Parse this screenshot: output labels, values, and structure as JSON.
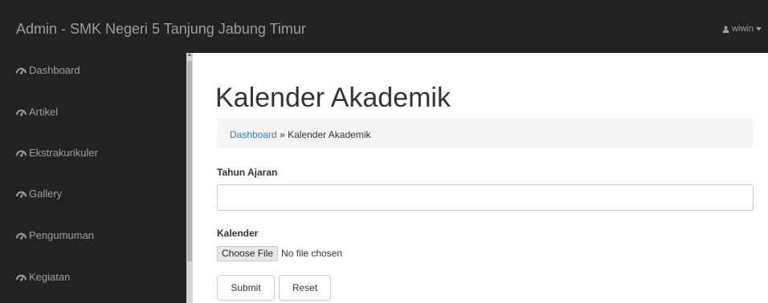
{
  "header": {
    "brand": "Admin - SMK Negeri 5 Tanjung Jabung Timur",
    "user": {
      "name": "wiwin",
      "icon": "user-icon",
      "caret_icon": "caret-down-icon"
    }
  },
  "sidebar": {
    "items": [
      {
        "label": "Dashboard",
        "icon": "dashboard-icon"
      },
      {
        "label": "Artikel",
        "icon": "dashboard-icon"
      },
      {
        "label": "Ekstrakurikuler",
        "icon": "dashboard-icon"
      },
      {
        "label": "Gallery",
        "icon": "dashboard-icon"
      },
      {
        "label": "Pengumuman",
        "icon": "dashboard-icon"
      },
      {
        "label": "Kegiatan",
        "icon": "dashboard-icon"
      }
    ]
  },
  "main": {
    "title": "Kalender Akademik",
    "breadcrumb": {
      "link": "Dashboard",
      "separator": "»",
      "current": "Kalender Akademik"
    },
    "form": {
      "tahun_label": "Tahun Ajaran",
      "tahun_value": "",
      "kalender_label": "Kalender",
      "file_button": "Choose File",
      "file_status": "No file chosen",
      "submit_label": "Submit",
      "reset_label": "Reset"
    }
  },
  "colors": {
    "navbar_bg": "#222222",
    "nav_text": "#9d9d9d",
    "link": "#337ab7",
    "breadcrumb_bg": "#f5f5f5"
  }
}
